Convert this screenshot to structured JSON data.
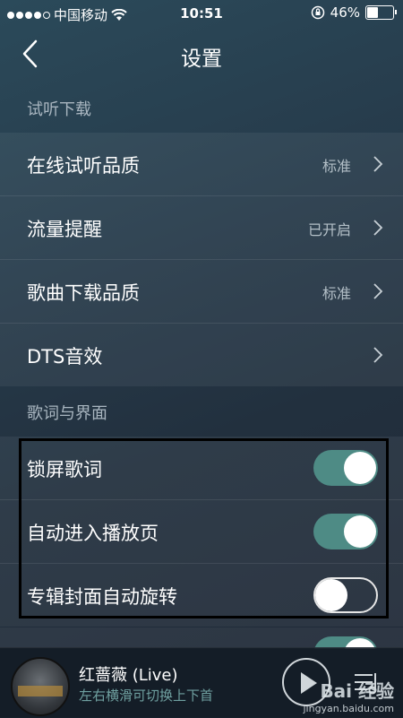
{
  "status_bar": {
    "carrier": "中国移动",
    "time": "10:51",
    "battery_percent": "46%",
    "battery_level": 0.46
  },
  "nav": {
    "title": "设置"
  },
  "sections": [
    {
      "header": "试听下载",
      "rows": [
        {
          "label": "在线试听品质",
          "value": "标准"
        },
        {
          "label": "流量提醒",
          "value": "已开启"
        },
        {
          "label": "歌曲下载品质",
          "value": "标准"
        },
        {
          "label": "DTS音效",
          "value": ""
        }
      ]
    },
    {
      "header": "歌词与界面",
      "rows": [
        {
          "label": "锁屏歌词",
          "toggle": true
        },
        {
          "label": "自动进入播放页",
          "toggle": true
        },
        {
          "label": "专辑封面自动旋转",
          "toggle": false
        }
      ]
    }
  ],
  "player": {
    "song_title": "红蔷薇 (Live)",
    "hint": "左右横滑可切换上下首"
  },
  "watermark": {
    "brand": "Bai 经验",
    "url": "jingyan.baidu.com"
  },
  "colors": {
    "toggle_on": "#4e8b85",
    "hint_text": "#6fa0a0"
  }
}
